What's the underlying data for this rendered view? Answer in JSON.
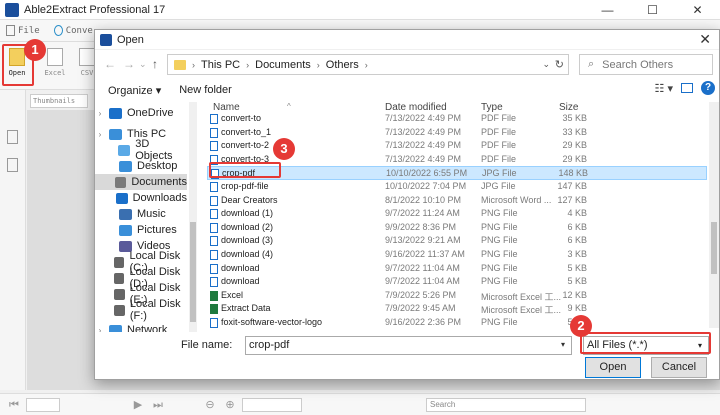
{
  "app": {
    "title": "Able2Extract Professional 17",
    "window_controls": [
      "—",
      "☐",
      "✕"
    ],
    "menu": {
      "file": "File",
      "convert": "Conve"
    },
    "ribbon": {
      "open": "Open",
      "excel": "Excel",
      "csv": "CSV"
    },
    "thumbnails_placeholder": "Thumbnails",
    "statusbar": {
      "search_placeholder": "Search"
    }
  },
  "dialog": {
    "title": "Open",
    "close_symbol": "✕",
    "breadcrumb": [
      "This PC",
      "Documents",
      "Others"
    ],
    "search_placeholder": "Search Others",
    "toolbar": {
      "organize": "Organize ▾",
      "new_folder": "New folder",
      "help": "?"
    },
    "nav_items": [
      {
        "label": "OneDrive",
        "icon": "cloud-icon"
      },
      {
        "label": "This PC",
        "icon": "computer-icon"
      },
      {
        "label": "3D Objects",
        "icon": "cube-icon"
      },
      {
        "label": "Desktop",
        "icon": "desktop-icon"
      },
      {
        "label": "Documents",
        "icon": "documents-icon"
      },
      {
        "label": "Downloads",
        "icon": "download-icon"
      },
      {
        "label": "Music",
        "icon": "music-icon"
      },
      {
        "label": "Pictures",
        "icon": "picture-icon"
      },
      {
        "label": "Videos",
        "icon": "video-icon"
      },
      {
        "label": "Local Disk (C:)",
        "icon": "disk-icon"
      },
      {
        "label": "Local Disk (D:)",
        "icon": "disk-icon"
      },
      {
        "label": "Local Disk (E:)",
        "icon": "disk-icon"
      },
      {
        "label": "Local Disk (F:)",
        "icon": "disk-icon"
      },
      {
        "label": "Network",
        "icon": "network-icon"
      }
    ],
    "columns": {
      "name": "Name",
      "date": "Date modified",
      "type": "Type",
      "size": "Size"
    },
    "files": [
      {
        "name": "convert-to",
        "date": "7/13/2022 4:49 PM",
        "type": "PDF File",
        "size": "35 KB"
      },
      {
        "name": "convert-to_1",
        "date": "7/13/2022 4:49 PM",
        "type": "PDF File",
        "size": "33 KB"
      },
      {
        "name": "convert-to-2",
        "date": "7/13/2022 4:49 PM",
        "type": "PDF File",
        "size": "29 KB"
      },
      {
        "name": "convert-to-3",
        "date": "7/13/2022 4:49 PM",
        "type": "PDF File",
        "size": "29 KB"
      },
      {
        "name": "crop-pdf",
        "date": "10/10/2022 6:55 PM",
        "type": "JPG File",
        "size": "148 KB"
      },
      {
        "name": "crop-pdf-file",
        "date": "10/10/2022 7:04 PM",
        "type": "JPG File",
        "size": "147 KB"
      },
      {
        "name": "Dear Creators",
        "date": "8/1/2022 10:10 PM",
        "type": "Microsoft Word ...",
        "size": "127 KB"
      },
      {
        "name": "download (1)",
        "date": "9/7/2022 11:24 AM",
        "type": "PNG File",
        "size": "4 KB"
      },
      {
        "name": "download (2)",
        "date": "9/9/2022 8:36 PM",
        "type": "PNG File",
        "size": "6 KB"
      },
      {
        "name": "download (3)",
        "date": "9/13/2022 9:21 AM",
        "type": "PNG File",
        "size": "6 KB"
      },
      {
        "name": "download (4)",
        "date": "9/16/2022 11:37 AM",
        "type": "PNG File",
        "size": "3 KB"
      },
      {
        "name": "download",
        "date": "9/7/2022 11:04 AM",
        "type": "PNG File",
        "size": "5 KB"
      },
      {
        "name": "download",
        "date": "9/7/2022 11:04 AM",
        "type": "PNG File",
        "size": "5 KB"
      },
      {
        "name": "Excel",
        "date": "7/9/2022 5:26 PM",
        "type": "Microsoft Excel 工...",
        "size": "12 KB"
      },
      {
        "name": "Extract Data",
        "date": "7/9/2022 9:45 AM",
        "type": "Microsoft Excel 工...",
        "size": "9 KB"
      },
      {
        "name": "foxit-software-vector-logo",
        "date": "9/16/2022 2:36 PM",
        "type": "PNG File",
        "size": "5 KB"
      }
    ],
    "file_name_label": "File name:",
    "file_name_value": "crop-pdf",
    "filter_value": "All Files (*.*)",
    "open_button": "Open",
    "cancel_button": "Cancel"
  },
  "annotations": {
    "badge1": "1",
    "badge2": "2",
    "badge3": "3",
    "color": "#e53935"
  }
}
